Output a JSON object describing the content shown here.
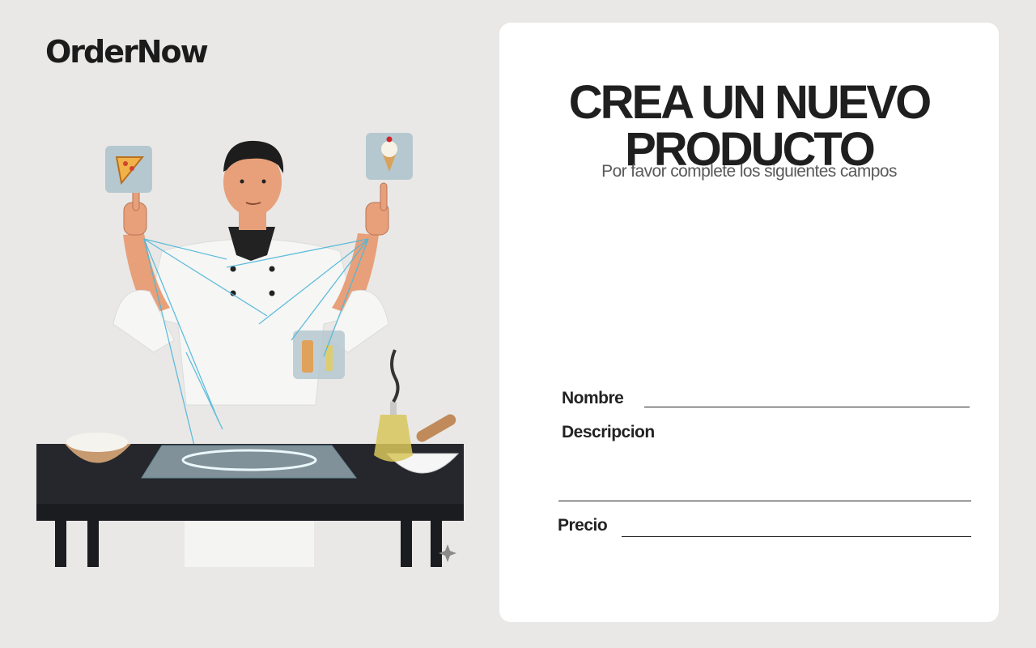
{
  "brand": {
    "name": "OrderNow"
  },
  "form": {
    "title_line1": "CREA UN NUEVO",
    "title_line2": "PRODUCTO",
    "subtitle": "Por favor complete los siguientes campos",
    "fields": {
      "nombre": {
        "label": "Nombre",
        "value": "",
        "placeholder": ""
      },
      "descripcion": {
        "label": "Descripcion",
        "value": "",
        "placeholder": ""
      },
      "precio": {
        "label": "Precio",
        "value": "",
        "placeholder": ""
      }
    }
  },
  "illustration": {
    "description_icons": [
      "pizza-icon",
      "ice-cream-icon",
      "condiments-icon"
    ]
  },
  "colors": {
    "background": "#e9e8e6",
    "card": "#ffffff",
    "text": "#1f1f1f",
    "hologram": "#4fb7d9"
  }
}
